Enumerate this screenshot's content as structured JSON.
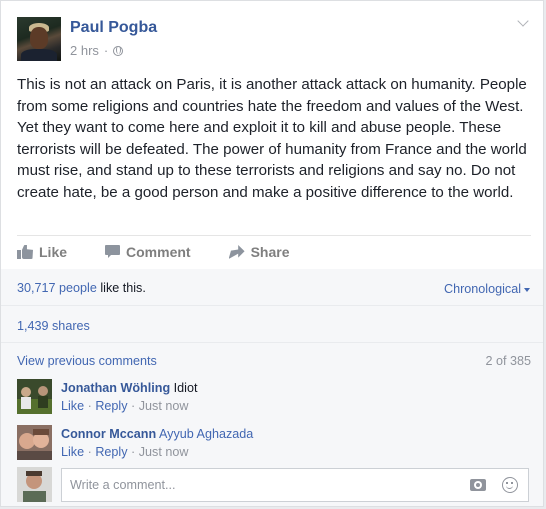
{
  "post": {
    "author": "Paul Pogba",
    "time": "2 hrs",
    "privacy_icon": "globe-icon",
    "text": "This is not an attack on Paris, it is another attack attack on humanity. People from some religions and countries hate the freedom and values of the West. Yet they want to come here and exploit it to kill and abuse people. These terrorists will be defeated. The power of humanity from France and the world must rise, and stand up to these terrorists and religions and say no. Do not create hate, be a good person and make a positive difference to the world."
  },
  "actions": {
    "like": "Like",
    "comment": "Comment",
    "share": "Share"
  },
  "reactions": {
    "count": "30,717 people",
    "suffix": "like this.",
    "order_label": "Chronological"
  },
  "shares": "1,439 shares",
  "comments_nav": {
    "view_previous": "View previous comments",
    "count": "2 of 385"
  },
  "comments": [
    {
      "author": "Jonathan Wöhling",
      "text": "Idiot",
      "like": "Like",
      "reply": "Reply",
      "time": "Just now"
    },
    {
      "author": "Connor Mccann",
      "text": "Ayyub Aghazada",
      "like": "Like",
      "reply": "Reply",
      "time": "Just now"
    }
  ],
  "composer": {
    "placeholder": "Write a comment..."
  },
  "colors": {
    "link": "#4267b2",
    "name": "#365899",
    "muted": "#90949c"
  }
}
